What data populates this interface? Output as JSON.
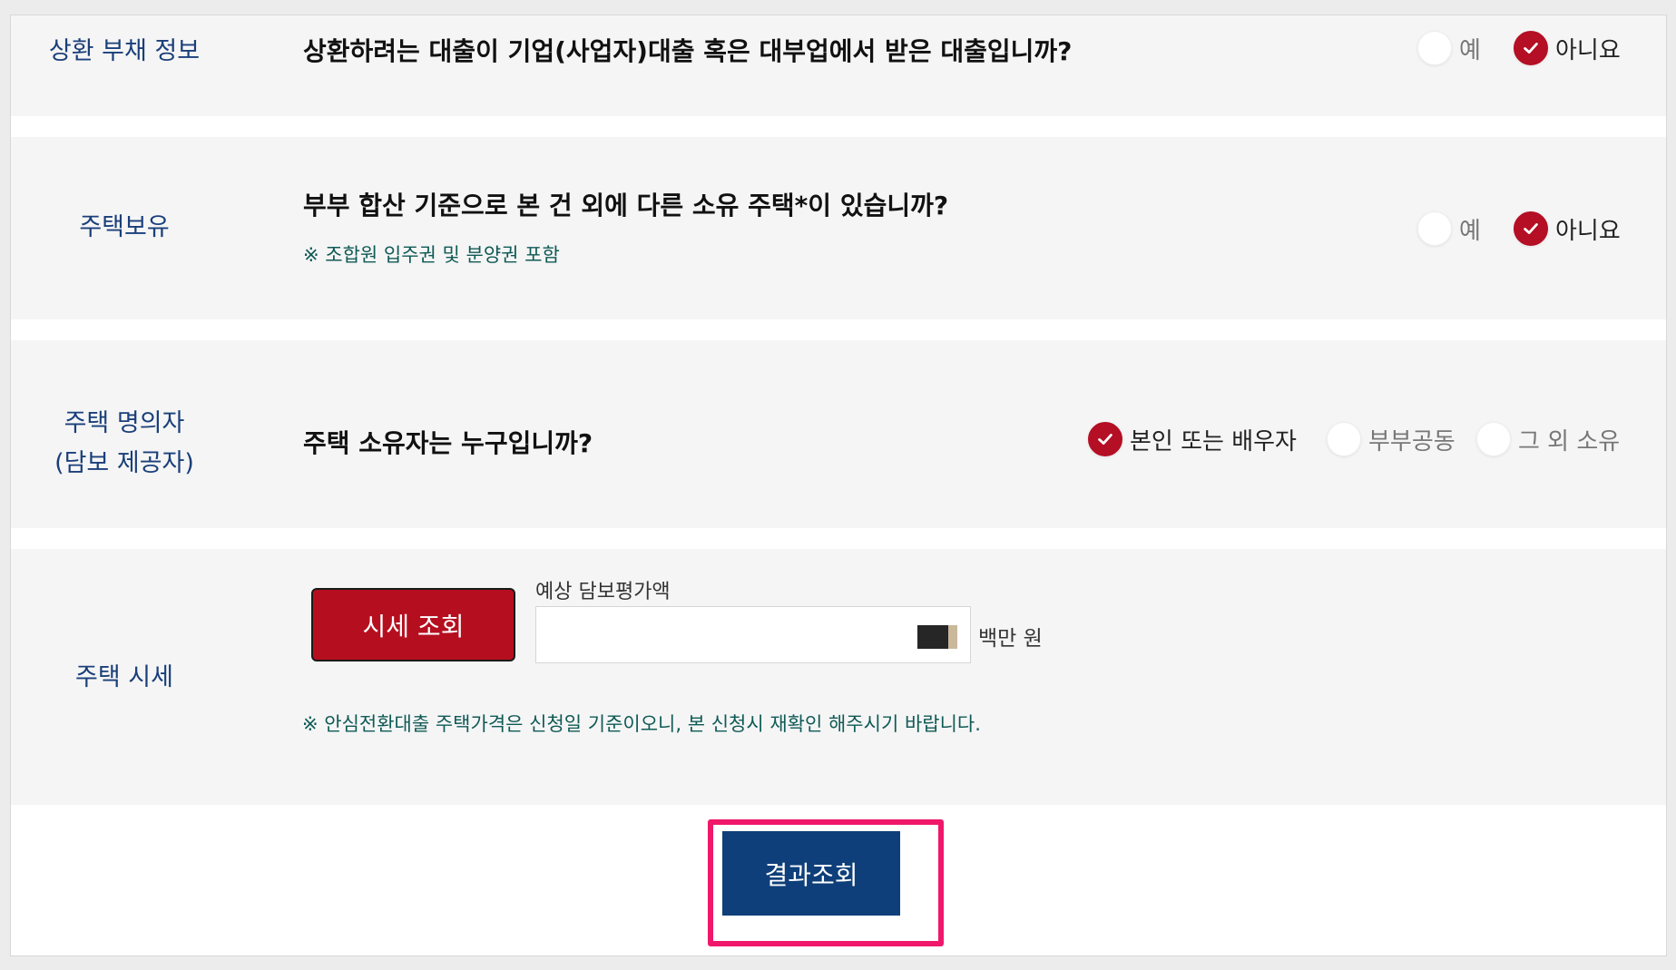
{
  "rows": {
    "debt": {
      "label": "상환 부채 정보",
      "question": "상환하려는 대출이 기업(사업자)대출 혹은 대부업에서 받은 대출입니까?",
      "options": [
        "예",
        "아니요"
      ],
      "selected": "아니요"
    },
    "ownership": {
      "label": "주택보유",
      "question": "부부 합산 기준으로 본 건 외에 다른 소유 주택*이 있습니까?",
      "note": "※ 조합원 입주권 및 분양권 포함",
      "options": [
        "예",
        "아니요"
      ],
      "selected": "아니요"
    },
    "owner": {
      "label_line1": "주택 명의자",
      "label_line2": "(담보 제공자)",
      "question": "주택 소유자는 누구입니까?",
      "options": [
        "본인 또는 배우자",
        "부부공동",
        "그 외 소유"
      ],
      "selected": "본인 또는 배우자"
    },
    "price": {
      "label": "주택 시세",
      "lookup_button": "시세 조회",
      "field_label": "예상 담보평가액",
      "field_value": "",
      "unit": "백만 원",
      "note": "※ 안심전환대출 주택가격은 신청일 기준이오니, 본 신청시 재확인 해주시기 바랍니다."
    }
  },
  "submit_button": "결과조회",
  "colors": {
    "accent_red": "#b40f24",
    "label_blue": "#1a3f7a",
    "note_green": "#0f5a55",
    "primary_blue": "#0e3f7a",
    "focus_pink": "#f0186a"
  },
  "icons": {
    "radio_checked": "checkmark-icon"
  }
}
